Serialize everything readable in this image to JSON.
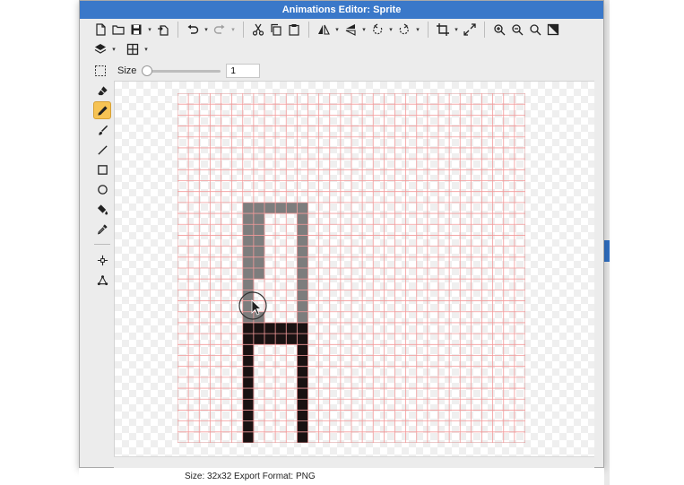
{
  "window": {
    "title": "Animations Editor: Sprite"
  },
  "toolbar": {
    "row1": [
      "new-file-icon",
      "open-folder-icon",
      "save-icon",
      "export-icon",
      "undo-icon",
      "redo-icon",
      "cut-icon",
      "copy-icon",
      "paste-icon",
      "flip-horizontal-icon",
      "flip-vertical-icon",
      "rotate-left-icon",
      "rotate-right-icon",
      "crop-icon",
      "resize-icon",
      "zoom-in-icon",
      "zoom-out-icon",
      "zoom-fit-icon",
      "fill-screen-icon"
    ],
    "row2": [
      "layers-icon",
      "grid-icon"
    ]
  },
  "brush": {
    "size_label": "Size",
    "size_value": "1",
    "slider_fraction": 0
  },
  "tools": [
    "eraser-icon",
    "pencil-icon",
    "brush-icon",
    "line-icon",
    "rectangle-icon",
    "ellipse-icon",
    "fill-bucket-icon",
    "eyedropper-icon",
    "move-point-icon",
    "transform-icon"
  ],
  "active_tool": "pencil-icon",
  "canvas": {
    "grid_cols": 32,
    "grid_rows": 32,
    "grid_color": "#f39a9a",
    "gray_color": "#7d7d7d",
    "dark_color": "#1a1212"
  },
  "status": {
    "text": "Size: 32x32   Export Format: PNG"
  }
}
